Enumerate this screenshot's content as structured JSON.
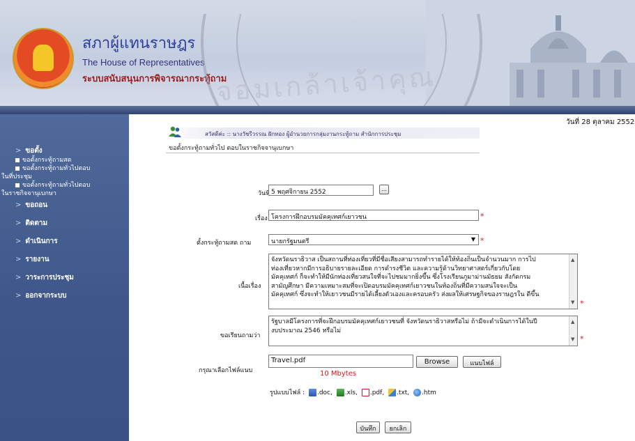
{
  "header": {
    "title_th": "สภาผู้แทนราษฎร",
    "title_en": "The House of Representatives",
    "system_name": "ระบบสนับสนุนการพิจารณากระทู้ถาม",
    "watermark_text": "จอมเกล้าเจ้าคุณ"
  },
  "date_top": "วันที่ 28 ตุลาคม 2552",
  "welcome": "สวัสดีค่ะ :: นางวัชรีวรรณ ฝักทอง ผู้อำนวยการกลุ่มงานกระทู้ถาม สำนักการประชุม",
  "page_heading": "ขอตั้งกระทู้ถามทั่วไป ตอบในราชกิจจานุเบกษา",
  "sidebar": {
    "item_request": "ขอตั้ง",
    "sub_1": "ขอตั้งกระทู้ถามสด",
    "sub_2_a": "ขอตั้งกระทู้ถามทั่วไปตอบ",
    "sub_2_b": "ในที่ประชุม",
    "sub_3_a": "ขอตั้งกระทู้ถามทั่วไปตอบ",
    "sub_3_b": "ในราชกิจจานุเบกษา",
    "item_withdraw": "ขอถอน",
    "item_follow": "ติดตาม",
    "item_process": "ดำเนินการ",
    "item_report": "รายงาน",
    "item_agenda": "วาระการประชุม",
    "item_logout": "ออกจากระบบ"
  },
  "form": {
    "date_label": "วันที่",
    "date_value": "5 พฤศจิกายน 2552",
    "calendar_button": "...",
    "subject_label": "เรื่อง",
    "subject_value": "โครงการฝึกอบรมมัคคุเทศก์เยาวชน",
    "ask_label": "ตั้งกระทู้ถามสด ถาม",
    "ask_value": "นายกรัฐมนตรี",
    "content_label": "เนื้อเรื่อง",
    "content_lines": [
      "จังหวัดนราธิวาส เป็นสถานที่ท่องเที่ยวที่มีชื่อเสียงสามารถทำรายได้ให้ท้องถิ่นเป็นจำนวนมาก การไป",
      "ท่องเที่ยวหากมีการอธิบายรายละเอียด การดำรงชีวิต และความรู้ด้านวิทยาศาสตร์เกี่ยวกับโดย",
      "มัคคุเทศก์ ก็จะทำให้มีนักท่องเที่ยวสนใจที่จะไปชมมากยิ่งขึ้น ซึ่งโรงเรียนภูมาม่านมัธยม สังกัดกรม",
      "สามัญศึกษา มีความเหมาะสมที่จะเปิดอบรมมัคคุเทศก์เยาวชนในท้องถิ่นที่มีความสนใจจะเป็น",
      "มัคคุเทศก์ ซึ่งจะทำให้เยาวชนมีรายได้เลี้ยงตัวเองและครอบครัว ส่งผลให้เศรษฐกิจของราษฎรใน ดีขึ้น"
    ],
    "question_label": "ขอเรียนถามว่า",
    "question_lines": [
      "รัฐบาลมีโครงการที่จะฝึกอบรมมัคคุเทศก์เยาวชนที่ จังหวัดนราธิวาสหรือไม่ ถ้ามีจะดำเนินการได้ในปี",
      "งบประมาณ 2546 หรือไม่"
    ],
    "file_label": "กรุณาเลือกไฟล์แนบ",
    "file_value": "Travel.pdf",
    "browse_button": "Browse",
    "attach_button": "แนบไฟล์",
    "size_note": "10 Mbytes",
    "types_label": "รูปแบบไฟล์ :",
    "type_doc": ".doc,",
    "type_xls": ".xls,",
    "type_pdf": ".pdf,",
    "type_txt": ".txt,",
    "type_htm": ".htm",
    "save_button": "บันทึก",
    "cancel_button": "ยกเลิก",
    "required_mark": "*"
  }
}
